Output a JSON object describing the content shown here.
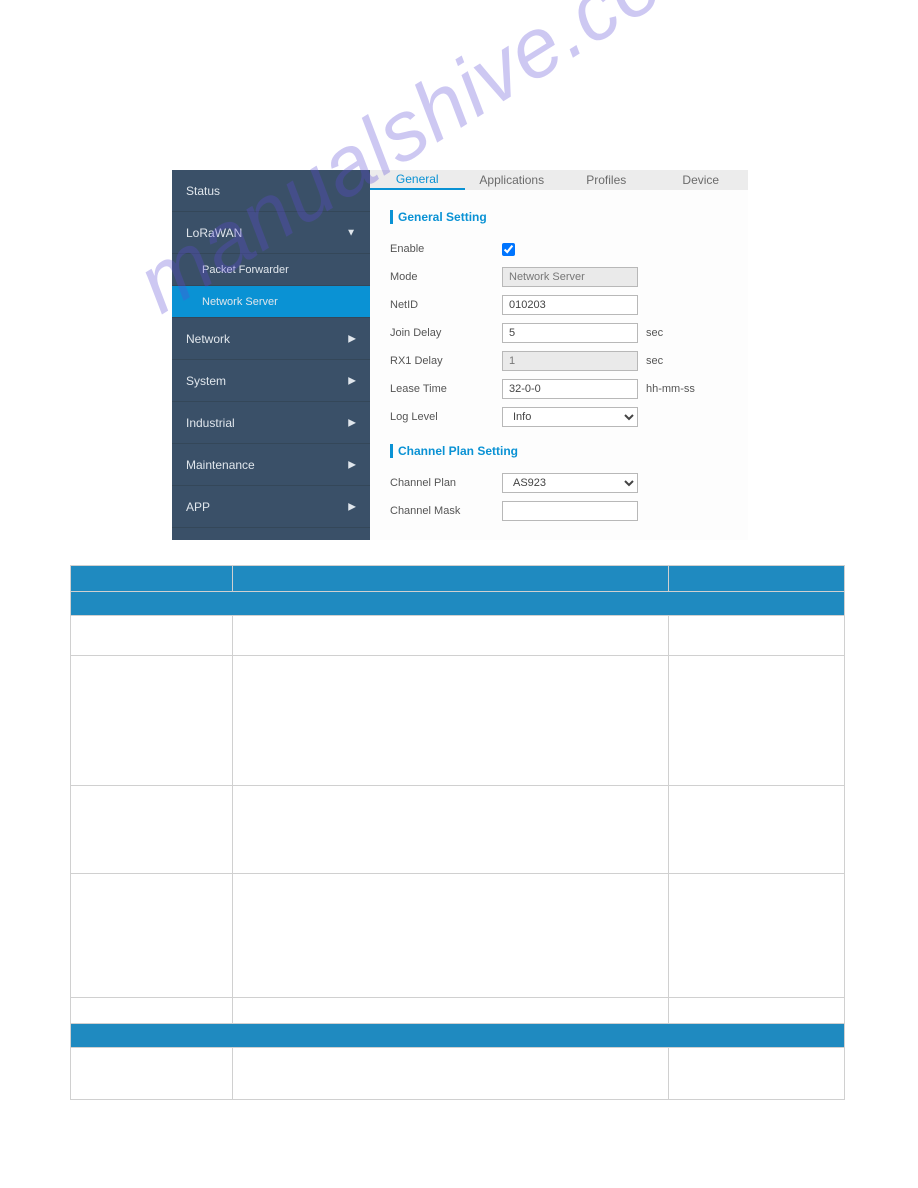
{
  "sidebar": {
    "items": [
      {
        "label": "Status",
        "caret": ""
      },
      {
        "label": "LoRaWAN",
        "caret": "▼",
        "children": [
          {
            "label": "Packet Forwarder",
            "active": false
          },
          {
            "label": "Network Server",
            "active": true
          }
        ]
      },
      {
        "label": "Network",
        "caret": "▶"
      },
      {
        "label": "System",
        "caret": "▶"
      },
      {
        "label": "Industrial",
        "caret": "▶"
      },
      {
        "label": "Maintenance",
        "caret": "▶"
      },
      {
        "label": "APP",
        "caret": "▶"
      }
    ]
  },
  "tabs": [
    "General",
    "Applications",
    "Profiles",
    "Device"
  ],
  "active_tab": "General",
  "general": {
    "title": "General Setting",
    "enable_label": "Enable",
    "enable_checked": true,
    "mode_label": "Mode",
    "mode_value": "Network Server",
    "netid_label": "NetID",
    "netid_value": "010203",
    "joindelay_label": "Join Delay",
    "joindelay_value": "5",
    "joindelay_suffix": "sec",
    "rx1_label": "RX1 Delay",
    "rx1_value": "1",
    "rx1_suffix": "sec",
    "lease_label": "Lease Time",
    "lease_value": "32-0-0",
    "lease_suffix": "hh-mm-ss",
    "log_label": "Log Level",
    "log_value": "Info"
  },
  "channel": {
    "title": "Channel Plan Setting",
    "plan_label": "Channel Plan",
    "plan_value": "AS923",
    "mask_label": "Channel Mask",
    "mask_value": ""
  },
  "watermark": "manualshive.com"
}
